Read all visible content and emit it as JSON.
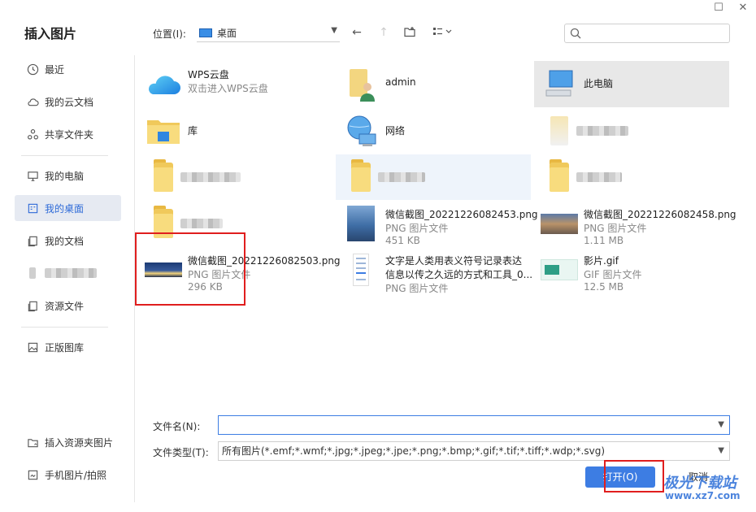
{
  "dialog": {
    "title": "插入图片"
  },
  "window": {
    "maximize_icon": "maximize-icon",
    "close_icon": "close-icon"
  },
  "sidebar": {
    "items": [
      {
        "label": "最近",
        "icon": "clock-icon"
      },
      {
        "label": "我的云文档",
        "icon": "cloud-icon"
      },
      {
        "label": "共享文件夹",
        "icon": "share-icon"
      },
      {
        "label": "我的电脑",
        "icon": "monitor-icon"
      },
      {
        "label": "我的桌面",
        "icon": "desktop-icon",
        "active": true
      },
      {
        "label": "我的文档",
        "icon": "document-icon"
      },
      {
        "label": "",
        "icon": "blurred-icon"
      },
      {
        "label": "资源文件",
        "icon": "resource-icon"
      },
      {
        "label": "正版图库",
        "icon": "gallery-icon"
      }
    ],
    "bottom": [
      {
        "label": "插入资源夹图片",
        "icon": "folder-image-icon"
      },
      {
        "label": "手机图片/拍照",
        "icon": "phone-image-icon"
      }
    ]
  },
  "toolbar": {
    "location_label": "位置(I):",
    "location_value": "桌面",
    "search_placeholder": ""
  },
  "files": [
    {
      "name": "WPS云盘",
      "line2": "双击进入WPS云盘",
      "line3": ""
    },
    {
      "name": "admin",
      "line2": "",
      "line3": ""
    },
    {
      "name": "此电脑",
      "line2": "",
      "line3": ""
    },
    {
      "name": "库",
      "line2": "",
      "line3": ""
    },
    {
      "name": "网络",
      "line2": "",
      "line3": ""
    },
    {
      "name": "",
      "line2": "",
      "line3": ""
    },
    {
      "name": "",
      "line2": "",
      "line3": ""
    },
    {
      "name": "",
      "line2": "",
      "line3": ""
    },
    {
      "name": "",
      "line2": "",
      "line3": ""
    },
    {
      "name": "",
      "line2": "",
      "line3": ""
    },
    {
      "name": "微信截图_20221226082453.png",
      "line2": "PNG 图片文件",
      "line3": "451 KB"
    },
    {
      "name": "微信截图_20221226082458.png",
      "line2": "PNG 图片文件",
      "line3": "1.11 MB"
    },
    {
      "name": "微信截图_20221226082503.png",
      "line2": "PNG 图片文件",
      "line3": "296 KB"
    },
    {
      "name": "文字是人类用表义符号记录表达",
      "name2": "信息以传之久远的方式和工具_0...",
      "line2": "PNG 图片文件",
      "line3": ""
    },
    {
      "name": "影片.gif",
      "line2": "GIF 图片文件",
      "line3": "12.5 MB"
    }
  ],
  "form": {
    "filename_label": "文件名(N):",
    "filename_value": "",
    "filetype_label": "文件类型(T):",
    "filetype_value": "所有图片(*.emf;*.wmf;*.jpg;*.jpeg;*.jpe;*.png;*.bmp;*.gif;*.tif;*.tiff;*.wdp;*.svg)",
    "open_button": "打开(O)",
    "cancel_button": "取消"
  },
  "watermark": {
    "text": "极光下载站",
    "url": "www.xz7.com"
  },
  "colors": {
    "accent": "#3d7de3",
    "highlight": "#e01e1e",
    "active_bg": "#e6eaf2"
  }
}
